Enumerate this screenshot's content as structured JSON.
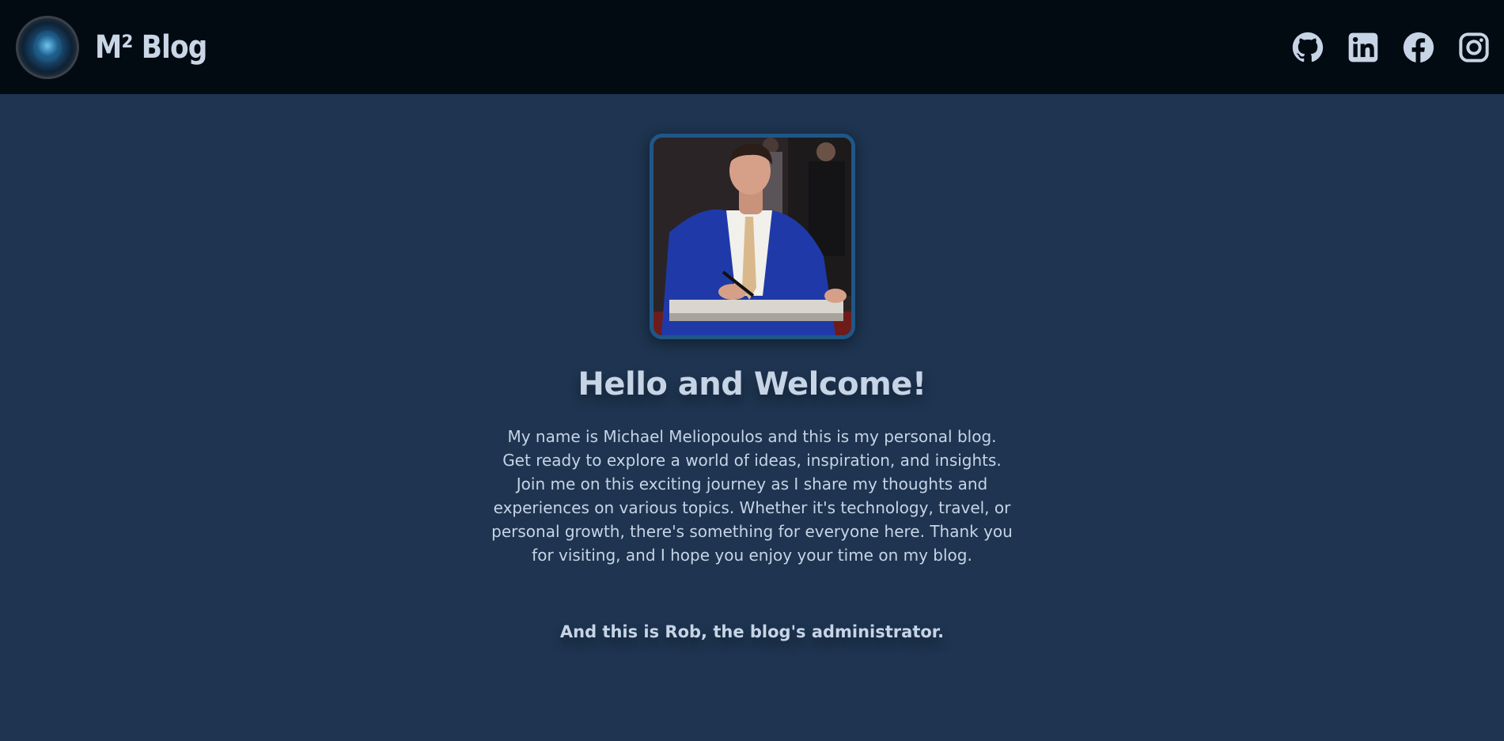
{
  "header": {
    "title": "M² Blog",
    "logo_icon": "blog-logo-icon",
    "social": [
      {
        "name": "github",
        "icon": "github-icon"
      },
      {
        "name": "linkedin",
        "icon": "linkedin-icon"
      },
      {
        "name": "facebook",
        "icon": "facebook-icon"
      },
      {
        "name": "instagram",
        "icon": "instagram-icon"
      }
    ]
  },
  "main": {
    "welcome": "Hello and Welcome!",
    "intro": "My name is Michael Meliopoulos and this is my personal blog. Get ready to explore a world of ideas, inspiration, and insights. Join me on this exciting journey as I share my thoughts and experiences on various topics. Whether it's technology, travel, or personal growth, there's something for everyone here. Thank you for visiting, and I hope you enjoy your time on my blog.",
    "admin_note": "And this is Rob, the blog's administrator."
  },
  "colors": {
    "header_bg": "#020a12",
    "page_bg": "#1e3450",
    "text": "#c6d4e6",
    "photo_border": "#1f5788"
  }
}
